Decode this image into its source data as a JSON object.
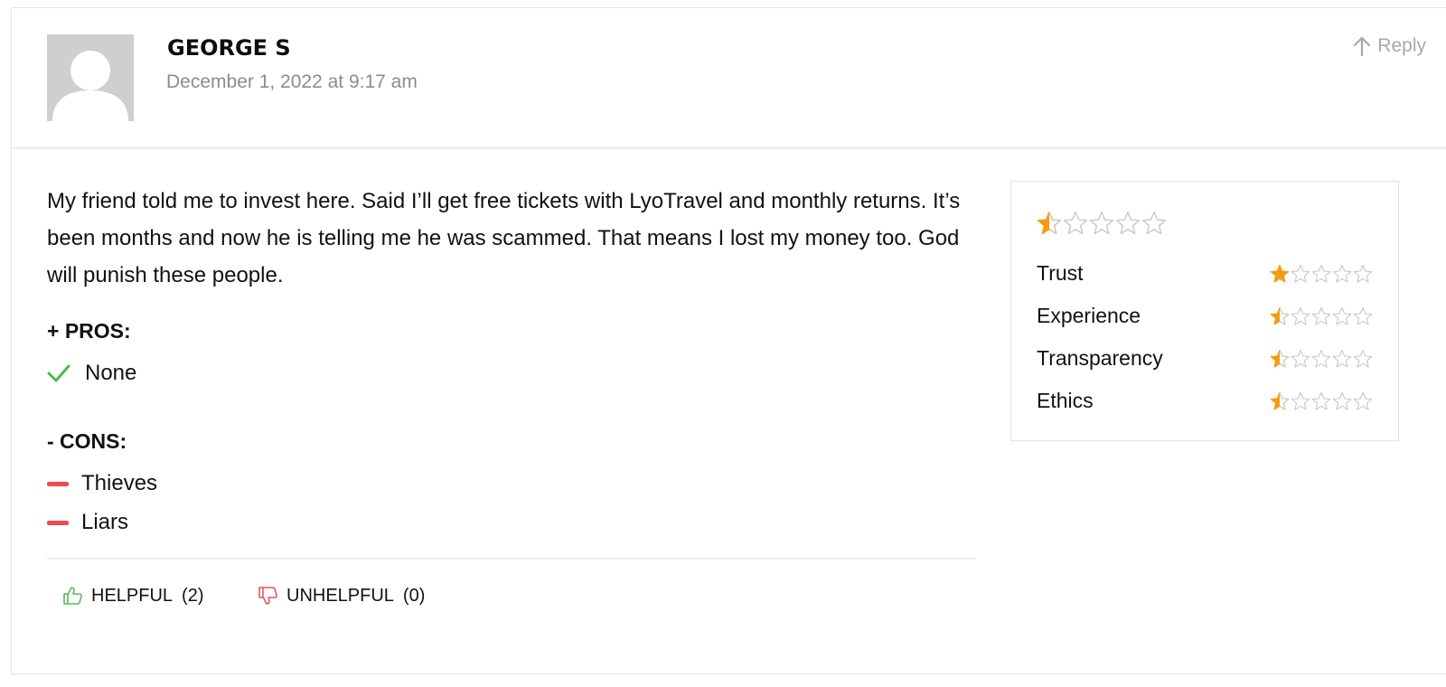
{
  "comment": {
    "author": "GEORGE S",
    "date": "December 1, 2022 at 9:17 am",
    "reply_label": "Reply",
    "text": "My friend told me to invest here. Said I’ll get free tickets with LyoTravel and monthly returns. It’s been months and now he is telling me he was scammed. That means I lost my money too. God will punish these people.",
    "pros_title": "+ PROS:",
    "pros": [
      "None"
    ],
    "cons_title": "- CONS:",
    "cons": [
      "Thieves",
      "Liars"
    ],
    "helpful_label": "HELPFUL",
    "helpful_count": "(2)",
    "unhelpful_label": "UNHELPFUL",
    "unhelpful_count": "(0)"
  },
  "rating": {
    "overall_stars": 0.5,
    "max_stars": 5,
    "criteria": [
      {
        "label": "Trust",
        "stars": 1
      },
      {
        "label": "Experience",
        "stars": 0.5
      },
      {
        "label": "Transparency",
        "stars": 0.5
      },
      {
        "label": "Ethics",
        "stars": 0.5
      }
    ]
  },
  "icons": {
    "reply": "arrow-up-icon",
    "pro": "check-icon",
    "con": "minus-icon",
    "helpful": "thumbs-up-icon",
    "unhelpful": "thumbs-down-icon",
    "star": "star-icon"
  },
  "colors": {
    "star_fill": "#f39c12",
    "star_empty": "#c8c8c8",
    "check": "#4cbb4a",
    "con_dash": "#ee4a52",
    "helpful_icon": "#5cb85c",
    "unhelpful_icon": "#e05a5a",
    "muted_text": "#8c8c8c"
  }
}
